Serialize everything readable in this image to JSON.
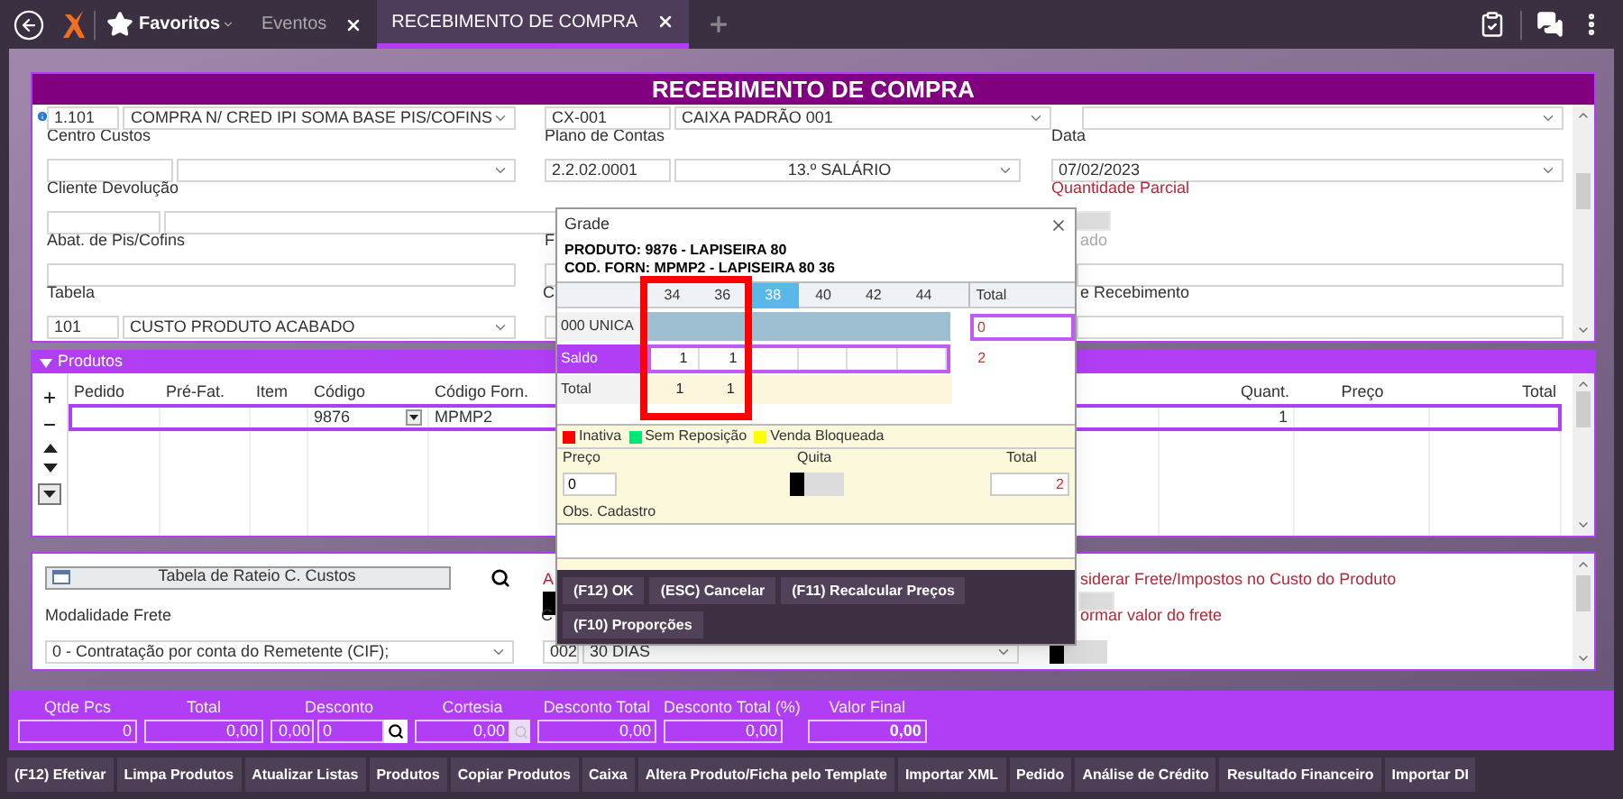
{
  "top_bar": {
    "favorites": "Favoritos",
    "tabs": [
      {
        "label": "Eventos",
        "selected": false
      },
      {
        "label": "RECEBIMENTO DE COMPRA",
        "selected": true
      }
    ]
  },
  "form": {
    "title": "RECEBIMENTO DE COMPRA",
    "operation_code": "1.101",
    "operation": "COMPRA N/ CRED IPI SOMA BASE PIS/COFINS",
    "cash_code": "CX-001",
    "cash": "CAIXA PADRÃO 001",
    "cost_center_label": "Centro Custos",
    "account_plan_label": "Plano de Contas",
    "account_code": "2.2.02.0001",
    "account": "13.º SALÁRIO",
    "date_label": "Data",
    "date": "07/02/2023",
    "return_client_label": "Cliente Devolução",
    "partial_qty_label": "Quantidade Parcial",
    "partial_qty_on": false,
    "pis_label": "Abat. de Pis/Cofins",
    "mid_label_1": "F",
    "right_label_1": "ado",
    "table_label": "Tabela",
    "mid_label_2": "C",
    "right_label_2": "e Recebimento",
    "table_code": "101",
    "table_name": "CUSTO PRODUTO ACABADO"
  },
  "products": {
    "title": "Produtos",
    "columns": [
      "Pedido",
      "Pré-Fat.",
      "Item",
      "Código",
      "Código Forn.",
      "Quant.",
      "Preço",
      "Total"
    ],
    "rows": [
      {
        "selected": true,
        "code": "9876",
        "supplier_code": "MPMP2",
        "quantity": "1"
      }
    ]
  },
  "lower": {
    "rateio_button": "Tabela de Rateio C. Custos",
    "mid_label_a": "A",
    "mid_toggle_on": false,
    "right_label_a": "siderar Frete/Impostos no Custo do Produto",
    "right_toggle_a_on": false,
    "freight_label": "Modalidade Frete",
    "mid_label_c": "C",
    "right_label_c": "ormar valor do frete",
    "freight": "0 - Contratação por conta do Remetente (CIF);",
    "term_code": "002",
    "term": "30 DIAS",
    "right_toggle_on": false
  },
  "totals": [
    {
      "label": "Qtde Pcs",
      "kind": "single",
      "values": [
        "0"
      ]
    },
    {
      "label": "Total",
      "kind": "single",
      "values": [
        "0,00"
      ]
    },
    {
      "label": "Desconto",
      "kind": "search",
      "values": [
        "0,00",
        "0"
      ]
    },
    {
      "label": "Cortesia",
      "kind": "lookup",
      "values": [
        "0,00"
      ]
    },
    {
      "label": "Desconto Total",
      "kind": "single",
      "values": [
        "0,00"
      ]
    },
    {
      "label": "Desconto Total (%)",
      "kind": "single",
      "values": [
        "0,00"
      ]
    },
    {
      "label": "Valor Final",
      "kind": "final",
      "values": [
        "0,00"
      ]
    }
  ],
  "buttons": [
    "(F12) Efetivar",
    "Limpa Produtos",
    "Atualizar Listas",
    "Produtos",
    "Copiar Produtos",
    "Caixa",
    "Altera Produto/Ficha pelo Template",
    "Importar XML",
    "Pedido",
    "Análise de Crédito",
    "Resultado Financeiro",
    "Importar DI"
  ],
  "grade_dialog": {
    "title": "Grade",
    "product": "PRODUTO: 9876 - LAPISEIRA 80",
    "supplier_code": "COD. FORN: MPMP2 - LAPISEIRA 80 36",
    "sizes": [
      {
        "label": "34",
        "selected": false
      },
      {
        "label": "36",
        "selected": false
      },
      {
        "label": "38",
        "selected": true
      },
      {
        "label": "40",
        "selected": false
      },
      {
        "label": "42",
        "selected": false
      },
      {
        "label": "44",
        "selected": false
      }
    ],
    "total_header": "Total",
    "rows": [
      {
        "kind": "stock",
        "label": "000 UNICA",
        "total": "0"
      },
      {
        "kind": "balance",
        "label": "Saldo",
        "values": [
          "1",
          "1"
        ],
        "total": "2"
      },
      {
        "kind": "sum",
        "label": "Total",
        "values": [
          "1",
          "1"
        ]
      }
    ],
    "legend": [
      {
        "label": "Inativa",
        "color": "#ff0000"
      },
      {
        "label": "Sem Reposição",
        "color": "#00e676"
      },
      {
        "label": "Venda Bloqueada",
        "color": "#ffff00"
      }
    ],
    "price_label": "Preço",
    "price": "0",
    "quita_label": "Quita",
    "quita_on": false,
    "total_label": "Total",
    "total": "2",
    "obs_label": "Obs. Cadastro",
    "buttons": [
      "(F12) OK",
      "(ESC) Cancelar",
      "(F11) Recalcular Preços",
      "(F10) Proporções"
    ]
  }
}
